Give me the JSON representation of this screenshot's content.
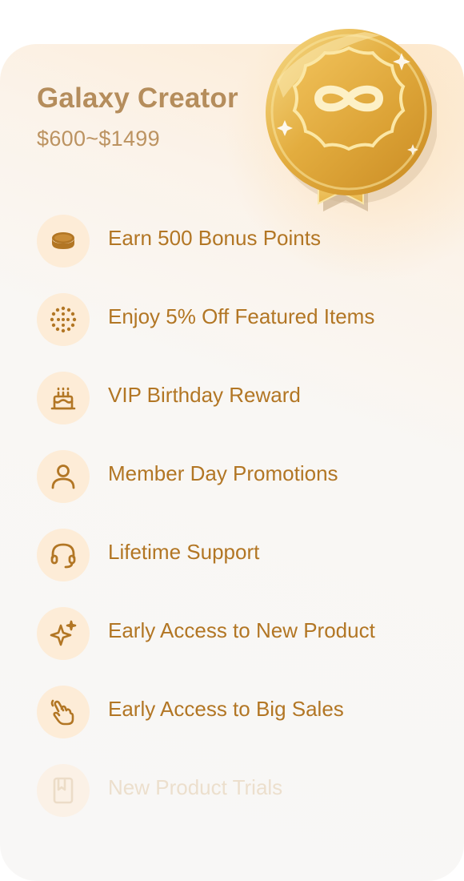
{
  "tier": {
    "title": "Galaxy Creator",
    "range": "$600~$1499",
    "badge_icon": "infinity-medal-icon"
  },
  "colors": {
    "accent": "#b27624",
    "title": "#b58d5c",
    "icon_bg": "#fdecd7",
    "muted_text": "#ecdfcd",
    "gold": "#e8b94a"
  },
  "benefits": [
    {
      "label": "Earn 500 Bonus Points",
      "icon": "coin-icon",
      "enabled": true
    },
    {
      "label": "Enjoy 5% Off Featured Items",
      "icon": "dotted-circle-icon",
      "enabled": true
    },
    {
      "label": "VIP Birthday Reward",
      "icon": "cake-icon",
      "enabled": true
    },
    {
      "label": "Member Day Promotions",
      "icon": "person-icon",
      "enabled": true
    },
    {
      "label": "Lifetime Support",
      "icon": "headset-icon",
      "enabled": true
    },
    {
      "label": "Early Access to New Product",
      "icon": "sparkle-icon",
      "enabled": true
    },
    {
      "label": "Early Access to Big Sales",
      "icon": "tap-hand-icon",
      "enabled": true
    },
    {
      "label": "New Product Trials",
      "icon": "bookmark-icon",
      "enabled": false
    }
  ]
}
